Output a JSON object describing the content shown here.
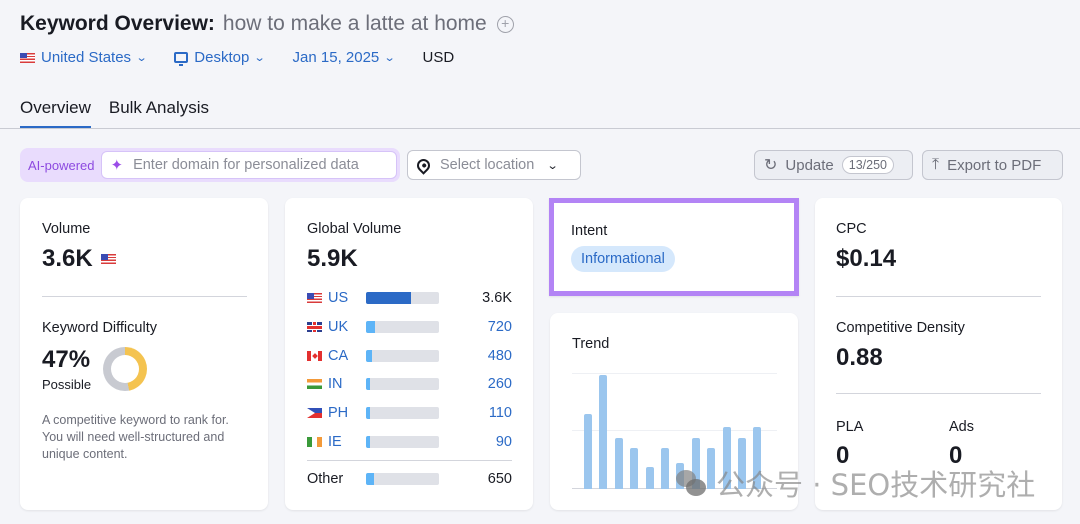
{
  "header": {
    "title": "Keyword Overview:",
    "keyword": "how to make a latte at home",
    "add_icon": "plus-circle-icon"
  },
  "filters": {
    "country": "United States",
    "device": "Desktop",
    "date": "Jan 15, 2025",
    "currency": "USD"
  },
  "tabs": [
    {
      "label": "Overview",
      "active": true
    },
    {
      "label": "Bulk Analysis",
      "active": false
    }
  ],
  "toolbar": {
    "ai_label": "AI-powered",
    "domain_placeholder": "Enter domain for personalized data",
    "location_placeholder": "Select location",
    "update_label": "Update",
    "update_count": "13/250",
    "export_label": "Export to PDF"
  },
  "volume": {
    "label": "Volume",
    "value": "3.6K",
    "flag": "US"
  },
  "keyword_difficulty": {
    "label": "Keyword Difficulty",
    "value": "47%",
    "percent": 47,
    "rating": "Possible",
    "description": "A competitive keyword to rank for. You will need well-structured and unique content.",
    "colors": {
      "filled": "#f4c350",
      "empty": "#c8cad1"
    }
  },
  "global_volume": {
    "label": "Global Volume",
    "value": "5.9K",
    "countries": [
      {
        "code": "US",
        "value": "3.6K",
        "share": 0.61,
        "flag": "us"
      },
      {
        "code": "UK",
        "value": "720",
        "share": 0.12,
        "flag": "uk"
      },
      {
        "code": "CA",
        "value": "480",
        "share": 0.08,
        "flag": "ca"
      },
      {
        "code": "IN",
        "value": "260",
        "share": 0.044,
        "flag": "in"
      },
      {
        "code": "PH",
        "value": "110",
        "share": 0.019,
        "flag": "ph"
      },
      {
        "code": "IE",
        "value": "90",
        "share": 0.015,
        "flag": "ie"
      }
    ],
    "other": {
      "label": "Other",
      "value": "650",
      "share": 0.11
    }
  },
  "intent": {
    "label": "Intent",
    "badge": "Informational"
  },
  "trend": {
    "label": "Trend",
    "values": [
      0.66,
      1.0,
      0.45,
      0.36,
      0.19,
      0.36,
      0.23,
      0.45,
      0.36,
      0.54,
      0.45,
      0.54
    ]
  },
  "cpc": {
    "label": "CPC",
    "value": "$0.14"
  },
  "competitive_density": {
    "label": "Competitive Density",
    "value": "0.88"
  },
  "pla": {
    "label": "PLA",
    "value": "0"
  },
  "ads": {
    "label": "Ads",
    "value": "0"
  },
  "watermark": "公众号 · SEO技术研究社"
}
